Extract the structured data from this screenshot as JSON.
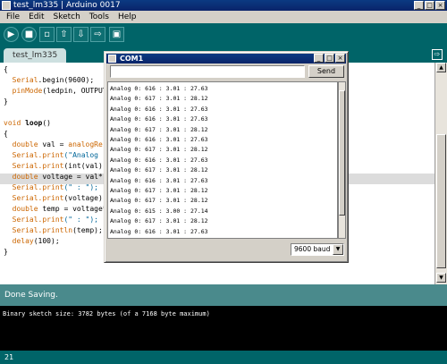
{
  "window": {
    "title": "test_lm335 | Arduino 0017",
    "minimize": "_",
    "maximize": "□",
    "close": "×"
  },
  "menubar": {
    "file": "File",
    "edit": "Edit",
    "sketch": "Sketch",
    "tools": "Tools",
    "help": "Help"
  },
  "toolbar": {
    "verify": "▶",
    "stop": "■",
    "new": "▫",
    "open": "⇧",
    "save": "⇩",
    "upload": "⇨",
    "serial_monitor": "▣"
  },
  "tabs": {
    "active_label": "test_lm335",
    "menu_icon": "⇨"
  },
  "editor": {
    "line1": "{",
    "line2_obj": "Serial",
    "line2_rest": ".begin(9600);",
    "line3_fn": "pinMode",
    "line3_rest": "(ledpin, OUTPUT",
    "line4": "}",
    "line5_kw": "void",
    "line5_fn": "loop",
    "line5_rest": "()",
    "line6": "{",
    "line7_kw": "double",
    "line7_mid": " val = ",
    "line7_fn": "analogRe",
    "line8_obj": "Serial",
    "line8_fn": ".print",
    "line8_str": "(\"Analog ",
    "line9_obj": "Serial",
    "line9_fn": ".print",
    "line9_rest": "(int(val)",
    "line10_kw": "double",
    "line10_rest": " voltage = val*",
    "line11_obj": "Serial",
    "line11_fn": ".print",
    "line11_str": "(\" : \");",
    "line12_obj": "Serial",
    "line12_fn": ".print",
    "line12_rest": "(voltage)",
    "line13_kw": "double",
    "line13_rest": " temp = voltage*",
    "line14_obj": "Serial",
    "line14_fn": ".print",
    "line14_str": "(\" : \");",
    "line15_obj": "Serial",
    "line15_fn": ".println",
    "line15_rest": "(temp);",
    "line16_fn": "delay",
    "line16_rest": "(100);",
    "line17": "}"
  },
  "status": {
    "message": "Done Saving."
  },
  "console": {
    "message": "Binary sketch size: 3782 bytes (of a 7168 byte maximum)"
  },
  "footer": {
    "line_number": "21"
  },
  "serial_monitor": {
    "title": "COM1",
    "input_value": "",
    "send_label": "Send",
    "baud_label": "9600 baud",
    "dropdown_icon": "▼",
    "lines": [
      "Analog 0: 616 : 3.01 : 27.63",
      "Analog 0: 617 : 3.01 : 28.12",
      "Analog 0: 616 : 3.01 : 27.63",
      "Analog 0: 616 : 3.01 : 27.63",
      "Analog 0: 617 : 3.01 : 28.12",
      "Analog 0: 616 : 3.01 : 27.63",
      "Analog 0: 617 : 3.01 : 28.12",
      "Analog 0: 616 : 3.01 : 27.63",
      "Analog 0: 617 : 3.01 : 28.12",
      "Analog 0: 616 : 3.01 : 27.63",
      "Analog 0: 617 : 3.01 : 28.12",
      "Analog 0: 617 : 3.01 : 28.12",
      "Analog 0: 615 : 3.00 : 27.14",
      "Analog 0: 617 : 3.01 : 28.12",
      "Analog 0: 616 : 3.01 : 27.63"
    ]
  }
}
